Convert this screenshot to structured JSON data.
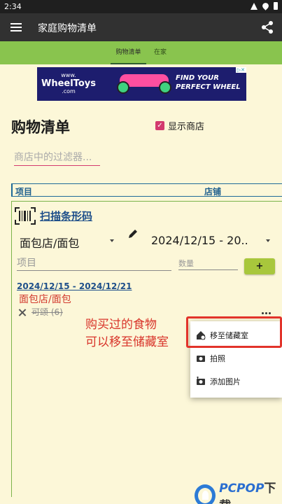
{
  "status_bar": {
    "time": "2:34"
  },
  "app_bar": {
    "title": "家庭购物清单"
  },
  "tabs": [
    {
      "label": "购物清单",
      "active": true
    },
    {
      "label": "在家",
      "active": false
    }
  ],
  "ad": {
    "logo_line1": "www.",
    "logo_line2": "WheelToys",
    "logo_line3": ".com",
    "headline_1": "FIND YOUR",
    "headline_2": "PERFECT WHEEL"
  },
  "page": {
    "title": "购物清单",
    "show_shops_label": "显示商店",
    "show_shops_checked": true,
    "filter_placeholder": "商店中的过滤器..."
  },
  "columns": {
    "item": "项目",
    "shop": "店铺"
  },
  "scan": {
    "label": "扫描条形码"
  },
  "form": {
    "category": "面包店/面包",
    "date_range": "2024/12/15 - 20..",
    "item_placeholder": "项目",
    "qty_placeholder": "数量",
    "add_label": "+"
  },
  "list": {
    "date_header": "2024/12/15 - 2024/12/21",
    "shop": "面包店/面包",
    "items": [
      {
        "name": "可颂 (6)",
        "bought": true
      }
    ]
  },
  "annotation": {
    "line1": "购买过的食物",
    "line2": "可以移至储藏室"
  },
  "popup_menu": [
    {
      "label": "移至储藏室",
      "icon": "pantry-move-icon"
    },
    {
      "label": "拍照",
      "icon": "camera-icon"
    },
    {
      "label": "添加图片",
      "icon": "add-photo-icon"
    }
  ],
  "watermark": {
    "brand": "PCPOP",
    "suffix": "下载"
  },
  "colors": {
    "background": "#fcf7d8",
    "app_bar": "#313131",
    "tabs": "#89c44e",
    "accent": "#d33a6e",
    "link": "#1e4f8a",
    "annotation": "#d8342a"
  }
}
